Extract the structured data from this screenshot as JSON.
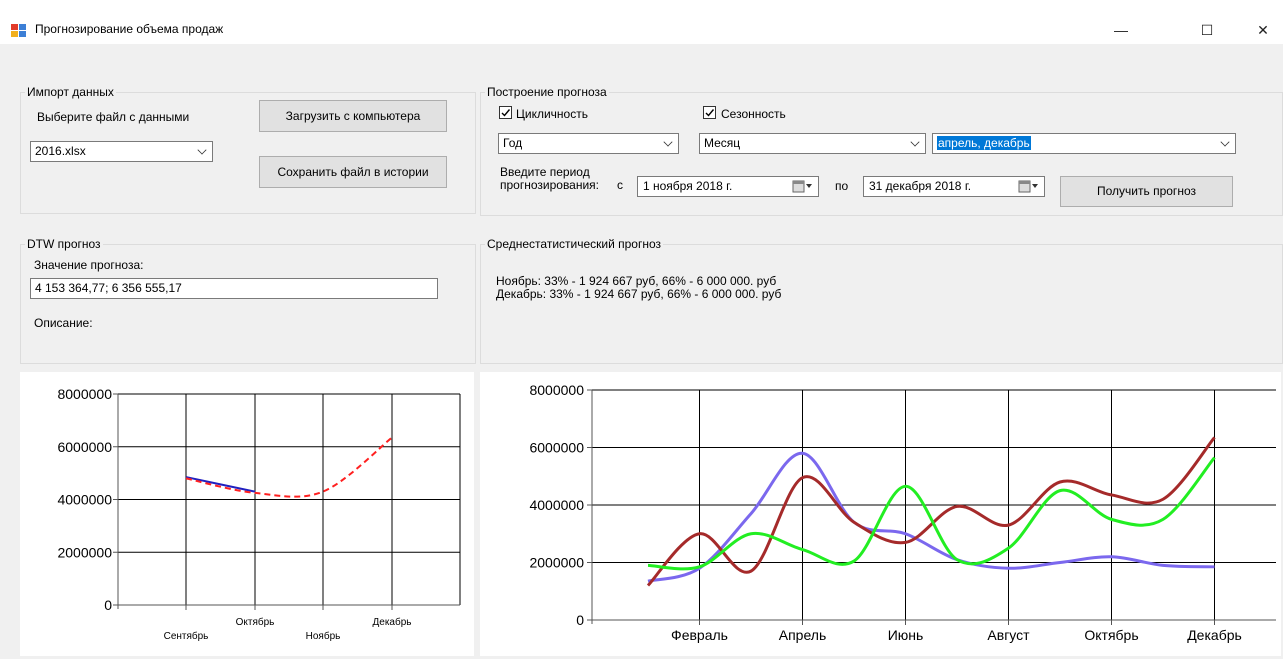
{
  "window": {
    "title": "Прогнозирование объема продаж",
    "minimize": "—",
    "maximize": "☐",
    "close": "✕"
  },
  "import": {
    "group_title": "Импорт данных",
    "choose_label": "Выберите файл с данными",
    "file_value": "2016.xlsx",
    "load_button": "Загрузить с компьютера",
    "save_button": "Сохранить файл в истории"
  },
  "forecast_build": {
    "group_title": "Построение прогноза",
    "cyclicity_label": "Цикличность",
    "cyclicity_checked": true,
    "seasonality_label": "Сезонность",
    "seasonality_checked": true,
    "cycle_period_value": "Год",
    "season_unit_value": "Месяц",
    "season_months_value": "апрель, декабрь",
    "period_label_1": "Введите период",
    "period_label_2": "прогнозирования:",
    "from_label": "с",
    "from_date": "1  ноября  2018 г.",
    "to_label": "по",
    "to_date": "31 декабря  2018 г.",
    "get_button": "Получить прогноз"
  },
  "dtw": {
    "group_title": "DTW прогноз",
    "value_label": "Значение прогноза:",
    "value": "4 153 364,77; 6 356 555,17",
    "description_label": "Описание:"
  },
  "stat": {
    "group_title": "Среднестатистический прогноз",
    "line1": "Ноябрь: 33% - 1 924 667 руб, 66% - 6 000 000. руб",
    "line2": "Декабрь: 33% - 1 924 667 руб, 66% - 6 000 000. руб"
  },
  "chart_data": [
    {
      "type": "line",
      "ylim": [
        0,
        8000000
      ],
      "yticks": [
        "8000000",
        "6000000",
        "4000000",
        "2000000",
        "0"
      ],
      "categories": [
        "Сентябрь",
        "Октябрь",
        "Ноябрь",
        "Декабрь"
      ],
      "series": [
        {
          "color": "#2020c0",
          "style": "solid",
          "x": [
            "Сентябрь",
            "Октябрь"
          ],
          "values": [
            4850000,
            4300000
          ]
        },
        {
          "color": "#ff2020",
          "style": "dashed",
          "x": [
            "Сентябрь",
            "Октябрь",
            "Ноябрь",
            "Декабрь"
          ],
          "values": [
            4800000,
            4250000,
            4300000,
            6350000
          ]
        }
      ]
    },
    {
      "type": "line",
      "ylim": [
        0,
        8000000
      ],
      "yticks": [
        "8000000",
        "6000000",
        "4000000",
        "2000000",
        "0"
      ],
      "xlabels": [
        "Февраль",
        "Апрель",
        "Июнь",
        "Август",
        "Октябрь",
        "Декабрь"
      ],
      "series": [
        {
          "color": "#7b68ee",
          "values": [
            1350000,
            1800000,
            3700000,
            5800000,
            3400000,
            3000000,
            2100000,
            1800000,
            2000000,
            2200000,
            1900000,
            1850000
          ]
        },
        {
          "color": "#a52a2a",
          "values": [
            1200000,
            3000000,
            1700000,
            4950000,
            3400000,
            2700000,
            3950000,
            3300000,
            4800000,
            4350000,
            4200000,
            6350000
          ]
        },
        {
          "color": "#22ee22",
          "values": [
            1900000,
            1850000,
            3000000,
            2450000,
            2050000,
            4650000,
            2100000,
            2500000,
            4500000,
            3500000,
            3500000,
            5650000
          ]
        }
      ]
    }
  ]
}
